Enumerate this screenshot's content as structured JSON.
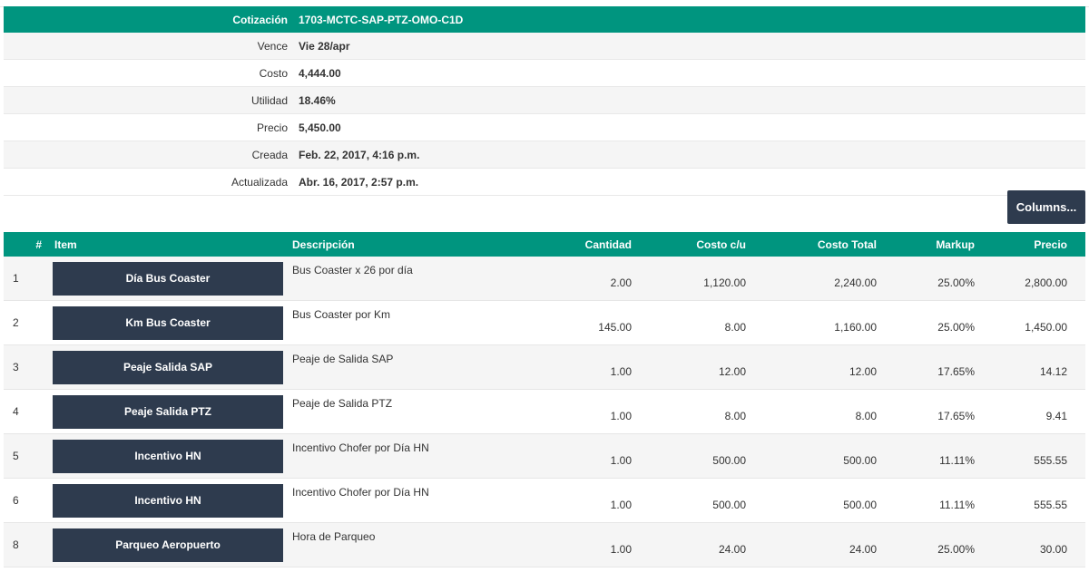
{
  "summary": {
    "cotizacion_label": "Cotización",
    "cotizacion_value": "1703-MCTC-SAP-PTZ-OMO-C1D",
    "rows": [
      {
        "label": "Vence",
        "value": "Vie 28/apr"
      },
      {
        "label": "Costo",
        "value": "4,444.00"
      },
      {
        "label": "Utilidad",
        "value": "18.46%"
      },
      {
        "label": "Precio",
        "value": "5,450.00"
      },
      {
        "label": "Creada",
        "value": "Feb. 22, 2017, 4:16 p.m."
      },
      {
        "label": "Actualizada",
        "value": "Abr. 16, 2017, 2:57 p.m."
      }
    ]
  },
  "toolbar": {
    "columns_label": "Columns..."
  },
  "table": {
    "headers": {
      "num": "#",
      "item": "Item",
      "desc": "Descripción",
      "cantidad": "Cantidad",
      "costo_cu": "Costo c/u",
      "costo_total": "Costo Total",
      "markup": "Markup",
      "precio": "Precio"
    },
    "rows": [
      {
        "num": "1",
        "item": "Día Bus Coaster",
        "desc": "Bus Coaster x 26 por día",
        "cantidad": "2.00",
        "costo_cu": "1,120.00",
        "costo_total": "2,240.00",
        "markup": "25.00%",
        "precio": "2,800.00"
      },
      {
        "num": "2",
        "item": "Km Bus Coaster",
        "desc": "Bus Coaster por Km",
        "cantidad": "145.00",
        "costo_cu": "8.00",
        "costo_total": "1,160.00",
        "markup": "25.00%",
        "precio": "1,450.00"
      },
      {
        "num": "3",
        "item": "Peaje Salida SAP",
        "desc": "Peaje de Salida SAP",
        "cantidad": "1.00",
        "costo_cu": "12.00",
        "costo_total": "12.00",
        "markup": "17.65%",
        "precio": "14.12"
      },
      {
        "num": "4",
        "item": "Peaje Salida PTZ",
        "desc": "Peaje de Salida PTZ",
        "cantidad": "1.00",
        "costo_cu": "8.00",
        "costo_total": "8.00",
        "markup": "17.65%",
        "precio": "9.41"
      },
      {
        "num": "5",
        "item": "Incentivo HN",
        "desc": "Incentivo Chofer por Día HN",
        "cantidad": "1.00",
        "costo_cu": "500.00",
        "costo_total": "500.00",
        "markup": "11.11%",
        "precio": "555.55"
      },
      {
        "num": "6",
        "item": "Incentivo HN",
        "desc": "Incentivo Chofer por Día HN",
        "cantidad": "1.00",
        "costo_cu": "500.00",
        "costo_total": "500.00",
        "markup": "11.11%",
        "precio": "555.55"
      },
      {
        "num": "8",
        "item": "Parqueo Aeropuerto",
        "desc": "Hora de Parqueo",
        "cantidad": "1.00",
        "costo_cu": "24.00",
        "costo_total": "24.00",
        "markup": "25.00%",
        "precio": "30.00"
      }
    ]
  },
  "colors": {
    "header_green": "#00957f",
    "dark_button": "#2e3b4e"
  }
}
